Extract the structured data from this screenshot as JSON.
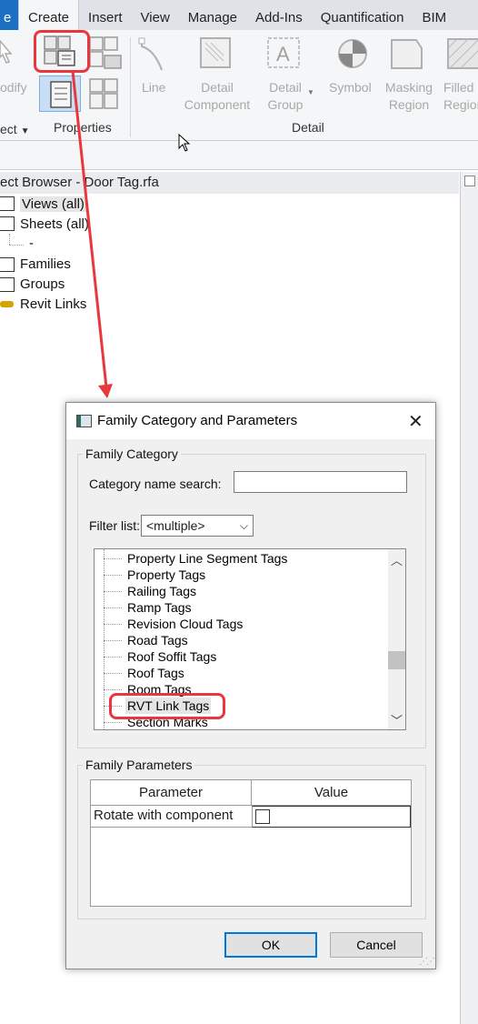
{
  "ribbon": {
    "tabs": [
      "e",
      "Create",
      "Insert",
      "View",
      "Manage",
      "Add-Ins",
      "Quantification",
      "BIM"
    ],
    "active_tab": "Create",
    "buttons": {
      "modify": "odify",
      "line": "Line",
      "detail_component": "Detail Component",
      "detail_group": "Detail Group",
      "symbol": "Symbol",
      "masking_region": "Masking Region",
      "filled_region": "Filled Region"
    },
    "panels": {
      "select": "ect",
      "properties": "Properties",
      "detail": "Detail"
    }
  },
  "browser": {
    "title": "ect Browser - Door Tag.rfa",
    "items": [
      "Views (all)",
      "Sheets (all)",
      "-",
      "Families",
      "Groups",
      "Revit Links"
    ]
  },
  "dialog": {
    "title": "Family Category and Parameters",
    "category_group": "Family Category",
    "search_label": "Category name search:",
    "search_value": "",
    "filter_label": "Filter list:",
    "filter_value": "<multiple>",
    "categories": [
      "Property Line Segment Tags",
      "Property Tags",
      "Railing Tags",
      "Ramp Tags",
      "Revision Cloud Tags",
      "Road Tags",
      "Roof Soffit Tags",
      "Roof Tags",
      "Room Tags",
      "RVT Link Tags",
      "Section Marks"
    ],
    "selected_category": "RVT Link Tags",
    "parameters_group": "Family Parameters",
    "param_headers": [
      "Parameter",
      "Value"
    ],
    "params": [
      {
        "name": "Rotate with component",
        "checked": false
      }
    ],
    "ok_label": "OK",
    "cancel_label": "Cancel"
  },
  "annotation_color": "#e8383d"
}
